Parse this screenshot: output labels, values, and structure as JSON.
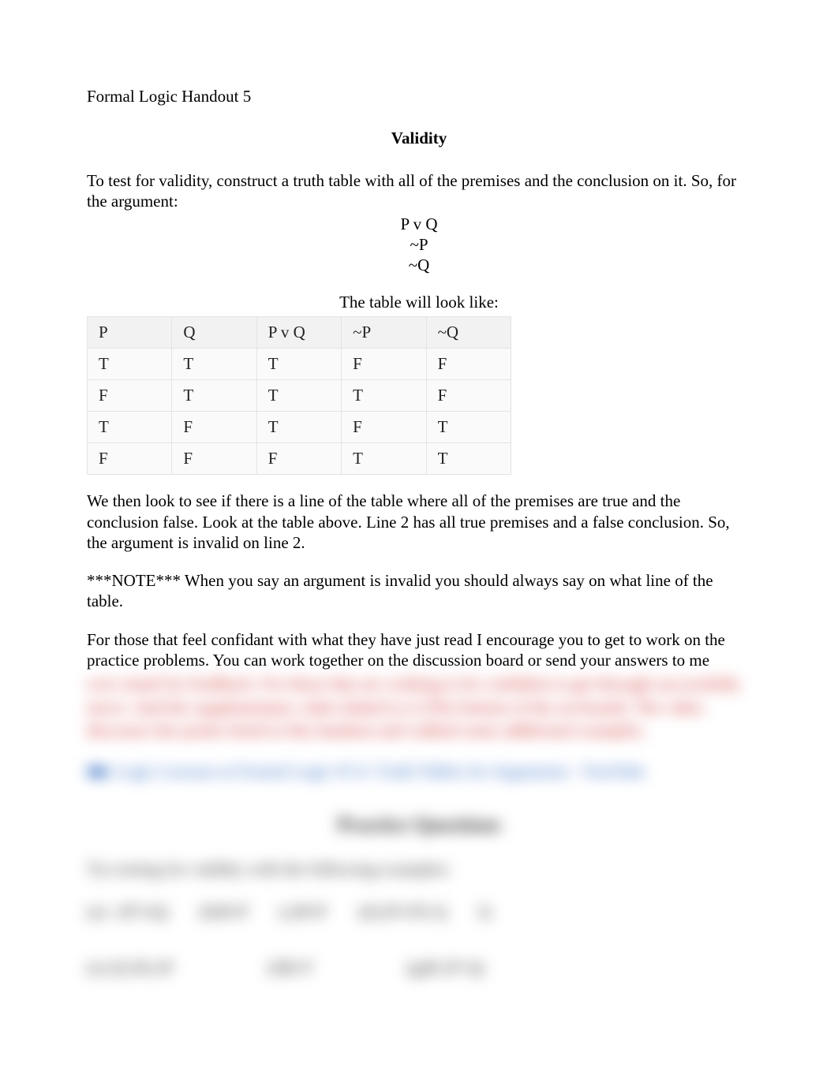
{
  "header": "Formal Logic Handout 5",
  "title": "Validity",
  "intro": "To test for validity, construct a truth table with all of the premises and the conclusion on it. So, for the argument:",
  "argument_l1": "P v Q",
  "argument_l2": "~P",
  "argument_l3": "~Q",
  "table_caption": "The table will look like:",
  "table": {
    "head": [
      "P",
      "Q",
      "P v Q",
      "~P",
      "~Q"
    ],
    "rows": [
      [
        "T",
        "T",
        "T",
        "F",
        "F"
      ],
      [
        "F",
        "T",
        "T",
        "T",
        "F"
      ],
      [
        "T",
        "F",
        "T",
        "F",
        "T"
      ],
      [
        "F",
        "F",
        "F",
        "T",
        "T"
      ]
    ]
  },
  "explain": "We then look to see if there is a line of the table where all of the premises are true and the conclusion false. Look at the table above. Line 2 has all true premises and a false conclusion. So, the argument is invalid on line 2.",
  "note": "***NOTE*** When you say an argument is invalid you should always say on what line of the table.",
  "encourage": "For those that feel confidant with what they have just read I encourage you to get to work on the practice problems. You can work together on the discussion board or send your answers to me",
  "blur": {
    "red_text": "over email for feedback. For those that are wishing to be confident to get through successfully move. And the supplementary video linked to it (The bottom of the on-board). The video discusses the points listed in this handout and walked some additional examples.",
    "blue_link": "■▶ Logic Lessons at Formal Logic #3 4- Truth Tables for Arguments - YouTube",
    "heading": "Practice Questions",
    "instruct": "Try testing for validity with the following examples:",
    "row1_a": "(a) ~(P⊃Q)",
    "row1_b": "(b)PvP",
    "row1_c": "(c)PvP",
    "row1_d": "(d) (P⊃P)·Q",
    "row1_e": "Q",
    "row2_a": "(e) (Q·R)·(P",
    "row2_b": "(f)R·P",
    "row2_c": "(g)R·(P·Q)"
  }
}
